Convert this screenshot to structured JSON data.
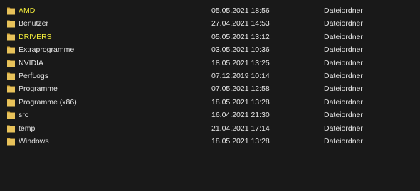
{
  "rows": [
    {
      "name": "AMD",
      "modified": "05.05.2021 18:56",
      "type": "Dateiordner",
      "highlighted": true
    },
    {
      "name": "Benutzer",
      "modified": "27.04.2021 14:53",
      "type": "Dateiordner",
      "highlighted": false
    },
    {
      "name": "DRIVERS",
      "modified": "05.05.2021 13:12",
      "type": "Dateiordner",
      "highlighted": true
    },
    {
      "name": "Extraprogramme",
      "modified": "03.05.2021 10:36",
      "type": "Dateiordner",
      "highlighted": false
    },
    {
      "name": "NVIDIA",
      "modified": "18.05.2021 13:25",
      "type": "Dateiordner",
      "highlighted": false
    },
    {
      "name": "PerfLogs",
      "modified": "07.12.2019 10:14",
      "type": "Dateiordner",
      "highlighted": false
    },
    {
      "name": "Programme",
      "modified": "07.05.2021 12:58",
      "type": "Dateiordner",
      "highlighted": false
    },
    {
      "name": "Programme (x86)",
      "modified": "18.05.2021 13:28",
      "type": "Dateiordner",
      "highlighted": false
    },
    {
      "name": "src",
      "modified": "16.04.2021 21:30",
      "type": "Dateiordner",
      "highlighted": false
    },
    {
      "name": "temp",
      "modified": "21.04.2021 17:14",
      "type": "Dateiordner",
      "highlighted": false
    },
    {
      "name": "Windows",
      "modified": "18.05.2021 13:28",
      "type": "Dateiordner",
      "highlighted": false
    }
  ],
  "colors": {
    "background": "#191919",
    "text": "#e6e6e6",
    "highlight_text": "#f5ee3a",
    "folder_body": "#e8c25a",
    "folder_tab": "#d4a93e"
  },
  "icons": {
    "folder": "folder-icon"
  }
}
